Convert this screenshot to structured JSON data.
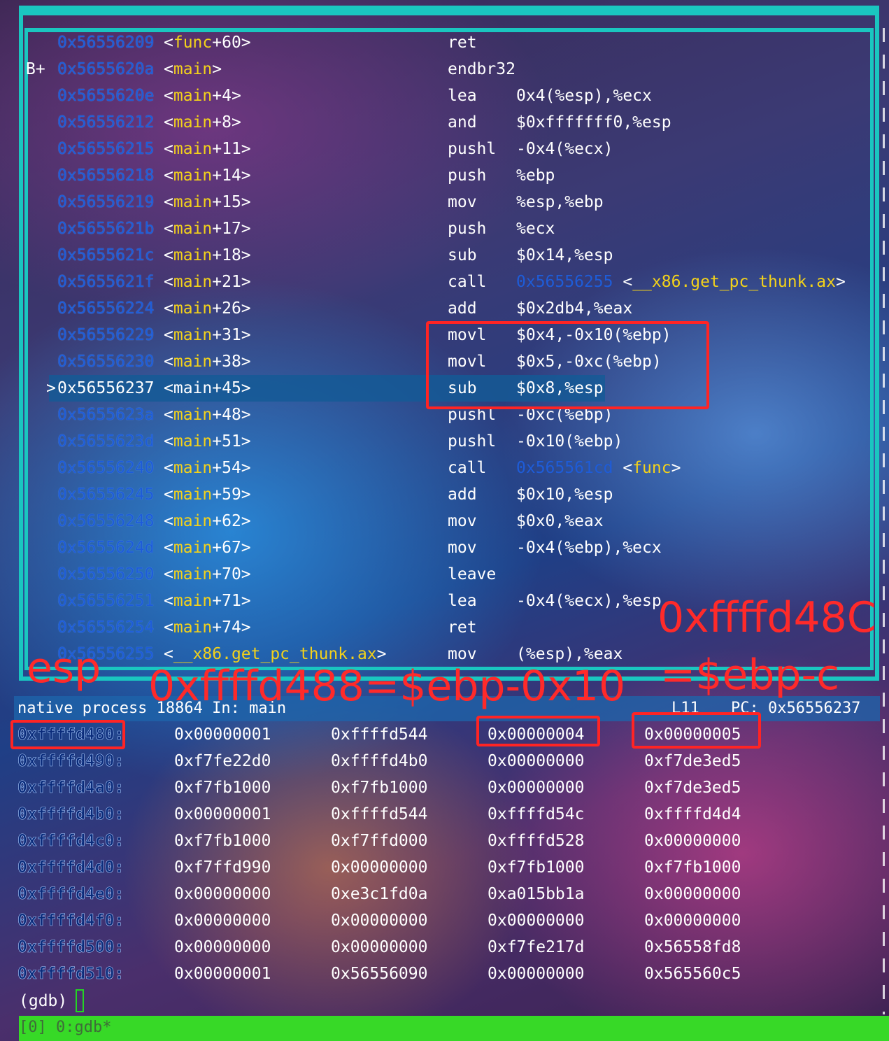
{
  "asm": [
    {
      "bp": "",
      "cur": "",
      "addr": "0x56556209",
      "sym": "func",
      "off": "+60",
      "mnem": "ret",
      "ops": ""
    },
    {
      "bp": "B+",
      "cur": "",
      "addr": "0x5655620a",
      "sym": "main",
      "off": "",
      "mnem": "endbr32",
      "ops": ""
    },
    {
      "bp": "",
      "cur": "",
      "addr": "0x5655620e",
      "sym": "main",
      "off": "+4",
      "mnem": "lea",
      "ops": "0x4(%esp),%ecx"
    },
    {
      "bp": "",
      "cur": "",
      "addr": "0x56556212",
      "sym": "main",
      "off": "+8",
      "mnem": "and",
      "ops": "$0xfffffff0,%esp"
    },
    {
      "bp": "",
      "cur": "",
      "addr": "0x56556215",
      "sym": "main",
      "off": "+11",
      "mnem": "pushl",
      "ops": "-0x4(%ecx)"
    },
    {
      "bp": "",
      "cur": "",
      "addr": "0x56556218",
      "sym": "main",
      "off": "+14",
      "mnem": "push",
      "ops": "%ebp"
    },
    {
      "bp": "",
      "cur": "",
      "addr": "0x56556219",
      "sym": "main",
      "off": "+15",
      "mnem": "mov",
      "ops": "%esp,%ebp"
    },
    {
      "bp": "",
      "cur": "",
      "addr": "0x5655621b",
      "sym": "main",
      "off": "+17",
      "mnem": "push",
      "ops": "%ecx"
    },
    {
      "bp": "",
      "cur": "",
      "addr": "0x5655621c",
      "sym": "main",
      "off": "+18",
      "mnem": "sub",
      "ops": "$0x14,%esp"
    },
    {
      "bp": "",
      "cur": "",
      "addr": "0x5655621f",
      "sym": "main",
      "off": "+21",
      "mnem": "call",
      "ops": "",
      "ref_addr": "0x56556255",
      "ref_sym": "__x86.get_pc_thunk.ax"
    },
    {
      "bp": "",
      "cur": "",
      "addr": "0x56556224",
      "sym": "main",
      "off": "+26",
      "mnem": "add",
      "ops": "$0x2db4,%eax"
    },
    {
      "bp": "",
      "cur": "",
      "addr": "0x56556229",
      "sym": "main",
      "off": "+31",
      "mnem": "movl",
      "ops": "$0x4,-0x10(%ebp)"
    },
    {
      "bp": "",
      "cur": "",
      "addr": "0x56556230",
      "sym": "main",
      "off": "+38",
      "mnem": "movl",
      "ops": "$0x5,-0xc(%ebp)"
    },
    {
      "bp": "",
      "cur": ">",
      "addr": "0x56556237",
      "sym": "main",
      "off": "+45",
      "mnem": "sub",
      "ops": "$0x8,%esp",
      "current": true
    },
    {
      "bp": "",
      "cur": "",
      "addr": "0x5655623a",
      "sym": "main",
      "off": "+48",
      "mnem": "pushl",
      "ops": "-0xc(%ebp)"
    },
    {
      "bp": "",
      "cur": "",
      "addr": "0x5655623d",
      "sym": "main",
      "off": "+51",
      "mnem": "pushl",
      "ops": "-0x10(%ebp)"
    },
    {
      "bp": "",
      "cur": "",
      "addr": "0x56556240",
      "sym": "main",
      "off": "+54",
      "mnem": "call",
      "ops": "",
      "ref_addr": "0x565561cd",
      "ref_sym": "func"
    },
    {
      "bp": "",
      "cur": "",
      "addr": "0x56556245",
      "sym": "main",
      "off": "+59",
      "mnem": "add",
      "ops": "$0x10,%esp"
    },
    {
      "bp": "",
      "cur": "",
      "addr": "0x56556248",
      "sym": "main",
      "off": "+62",
      "mnem": "mov",
      "ops": "$0x0,%eax"
    },
    {
      "bp": "",
      "cur": "",
      "addr": "0x5655624d",
      "sym": "main",
      "off": "+67",
      "mnem": "mov",
      "ops": "-0x4(%ebp),%ecx"
    },
    {
      "bp": "",
      "cur": "",
      "addr": "0x56556250",
      "sym": "main",
      "off": "+70",
      "mnem": "leave",
      "ops": ""
    },
    {
      "bp": "",
      "cur": "",
      "addr": "0x56556251",
      "sym": "main",
      "off": "+71",
      "mnem": "lea",
      "ops": "-0x4(%ecx),%esp"
    },
    {
      "bp": "",
      "cur": "",
      "addr": "0x56556254",
      "sym": "main",
      "off": "+74",
      "mnem": "ret",
      "ops": ""
    },
    {
      "bp": "",
      "cur": "",
      "addr": "0x56556255",
      "sym": "__x86.get_pc_thunk.ax",
      "off": "",
      "mnem": "mov",
      "ops": "(%esp),%eax"
    }
  ],
  "status": {
    "left": "native process 18864 In: main",
    "line": "L11",
    "pc": "PC: 0x56556237"
  },
  "memory": [
    {
      "addr": "0xffffd480:",
      "v": [
        "0x00000001",
        "0xffffd544",
        "0x00000004",
        "0x00000005"
      ]
    },
    {
      "addr": "0xffffd490:",
      "v": [
        "0xf7fe22d0",
        "0xffffd4b0",
        "0x00000000",
        "0xf7de3ed5"
      ]
    },
    {
      "addr": "0xffffd4a0:",
      "v": [
        "0xf7fb1000",
        "0xf7fb1000",
        "0x00000000",
        "0xf7de3ed5"
      ]
    },
    {
      "addr": "0xffffd4b0:",
      "v": [
        "0x00000001",
        "0xffffd544",
        "0xffffd54c",
        "0xffffd4d4"
      ]
    },
    {
      "addr": "0xffffd4c0:",
      "v": [
        "0xf7fb1000",
        "0xf7ffd000",
        "0xffffd528",
        "0x00000000"
      ]
    },
    {
      "addr": "0xffffd4d0:",
      "v": [
        "0xf7ffd990",
        "0x00000000",
        "0xf7fb1000",
        "0xf7fb1000"
      ]
    },
    {
      "addr": "0xffffd4e0:",
      "v": [
        "0x00000000",
        "0xe3c1fd0a",
        "0xa015bb1a",
        "0x00000000"
      ]
    },
    {
      "addr": "0xffffd4f0:",
      "v": [
        "0x00000000",
        "0x00000000",
        "0x00000000",
        "0x00000000"
      ]
    },
    {
      "addr": "0xffffd500:",
      "v": [
        "0x00000000",
        "0x00000000",
        "0xf7fe217d",
        "0x56558fd8"
      ]
    },
    {
      "addr": "0xffffd510:",
      "v": [
        "0x00000001",
        "0x56556090",
        "0x00000000",
        "0x565560c5"
      ]
    }
  ],
  "prompt": "(gdb)",
  "tmux": "[0] 0:gdb*",
  "annotations": {
    "esp_label": "esp",
    "ebp_0x10_label": "0xffffd488=$ebp-0x10",
    "ebp_c_line1": "0xffffd48C",
    "ebp_c_line2": "=$ebp-c"
  },
  "colors": {
    "frame": "#1ac6c0",
    "address": "#1e5cd8",
    "symbol": "#f3d21a",
    "highlight": "#145a96",
    "annotation": "#ff2424",
    "tmux_bar": "#37d927"
  }
}
